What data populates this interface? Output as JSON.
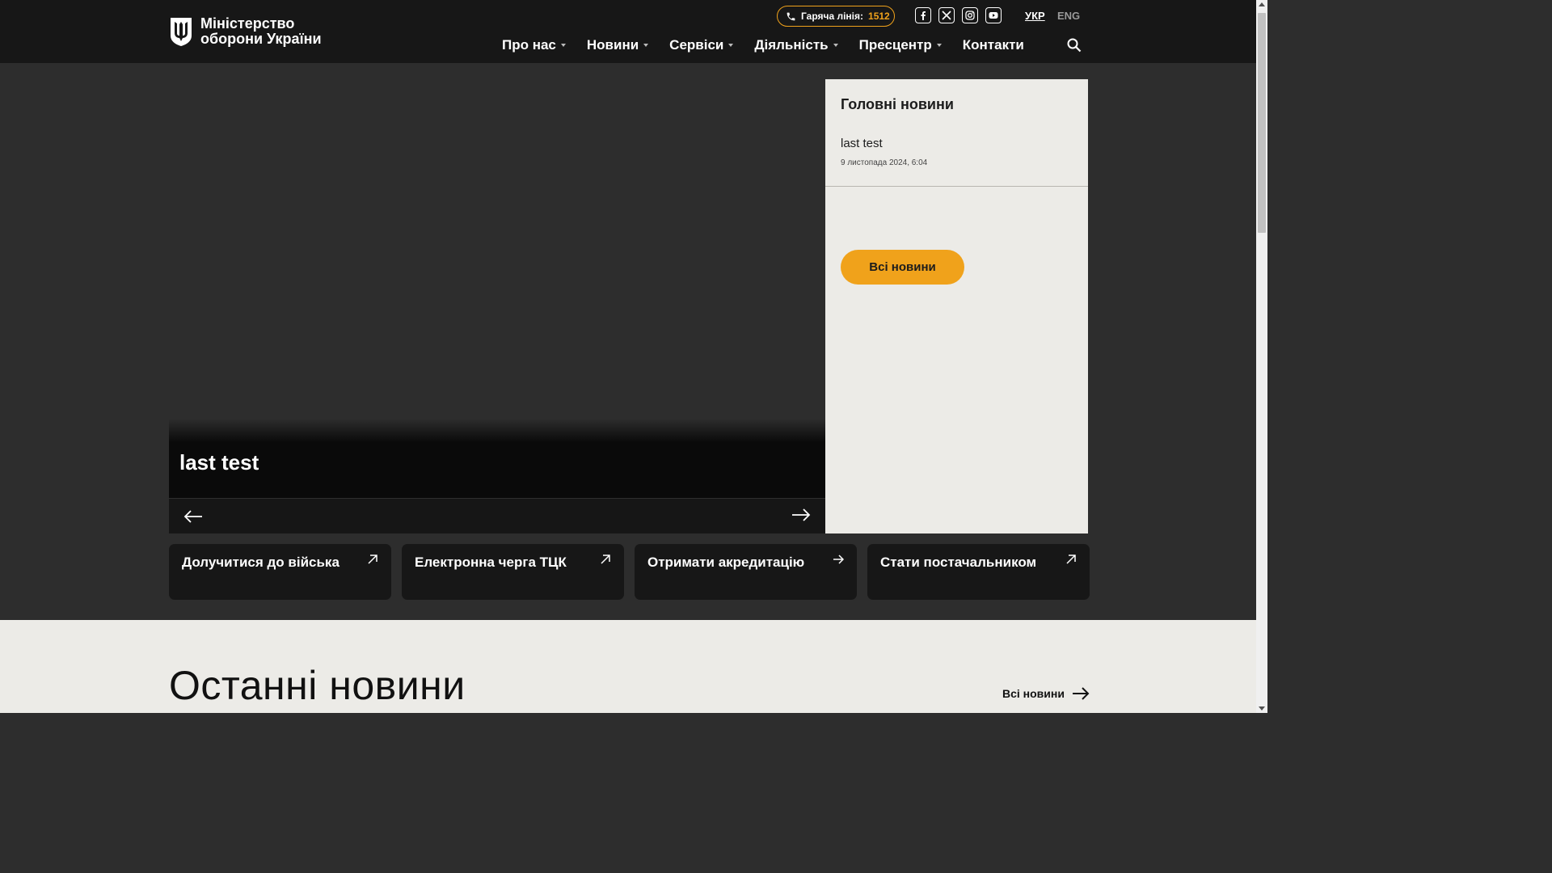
{
  "header": {
    "logo_line1": "Міністерство",
    "logo_line2": "оборони України",
    "hotline_label": "Гаряча лінія:",
    "hotline_number": "1512",
    "socials": [
      "facebook-icon",
      "x-icon",
      "instagram-icon",
      "youtube-icon"
    ],
    "lang_active": "УКР",
    "lang_other": "ENG",
    "nav": [
      {
        "label": "Про нас",
        "dropdown": true
      },
      {
        "label": "Новини",
        "dropdown": true
      },
      {
        "label": "Сервіси",
        "dropdown": true
      },
      {
        "label": "Діяльність",
        "dropdown": true
      },
      {
        "label": "Пресцентр",
        "dropdown": true
      },
      {
        "label": "Контакти",
        "dropdown": false
      }
    ]
  },
  "hero": {
    "title": "last test"
  },
  "sidebar": {
    "heading": "Головні новини",
    "news_title": "last test",
    "news_date": "9 листопада 2024, 6:04",
    "all_button": "Всі новини"
  },
  "cards": [
    {
      "label": "Долучитися до війська",
      "icon": "arrow-up-right-icon"
    },
    {
      "label": "Електронна черга ТЦК",
      "icon": "arrow-up-right-icon"
    },
    {
      "label": "Отримати акредитацію",
      "icon": "arrow-right-icon"
    },
    {
      "label": "Стати постачальником",
      "icon": "arrow-up-right-icon"
    }
  ],
  "latest": {
    "heading": "Останні новини",
    "all_link": "Всі новини"
  },
  "colors": {
    "accent": "#f0a21b",
    "header_bg": "#171717",
    "page_bg": "#2d2d2d",
    "light_bg": "#ecebe7"
  }
}
